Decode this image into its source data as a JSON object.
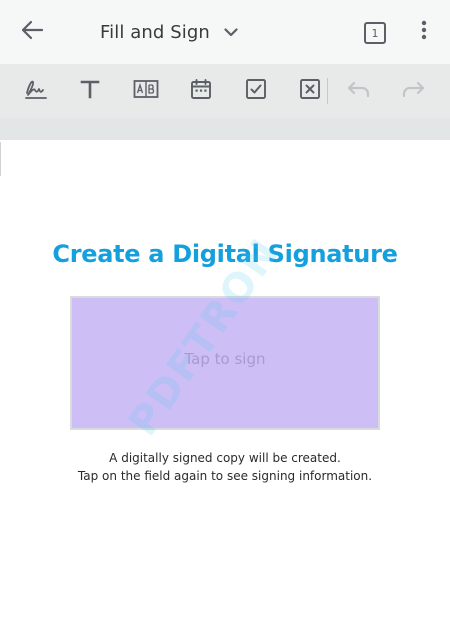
{
  "appbar": {
    "title": "Fill and Sign",
    "page_count": "1",
    "icons": {
      "back": "back-arrow-icon",
      "dropdown": "chevron-down-icon",
      "more": "more-vertical-icon"
    }
  },
  "toolbar": {
    "tools": [
      {
        "name": "signature-tool",
        "icon": "signature-icon"
      },
      {
        "name": "text-tool",
        "icon": "text-icon"
      },
      {
        "name": "comb-text-tool",
        "icon": "comb-text-icon"
      },
      {
        "name": "date-tool",
        "icon": "calendar-icon"
      },
      {
        "name": "checkmark-tool",
        "icon": "checkbox-icon"
      },
      {
        "name": "cross-tool",
        "icon": "cross-box-icon"
      },
      {
        "name": "undo-tool",
        "icon": "undo-icon"
      },
      {
        "name": "redo-tool",
        "icon": "redo-icon"
      }
    ]
  },
  "document": {
    "heading": "Create a Digital Signature",
    "field_placeholder": "Tap to sign",
    "info_line_1": "A digitally signed copy will be created.",
    "info_line_2": "Tap on the field again to see signing information.",
    "watermark": "PDFTRON"
  },
  "colors": {
    "heading": "#149fdd",
    "field_fill": "#cdbff6",
    "toolbar_bg": "#e8eaea",
    "appbar_bg": "#f6f7f7"
  }
}
